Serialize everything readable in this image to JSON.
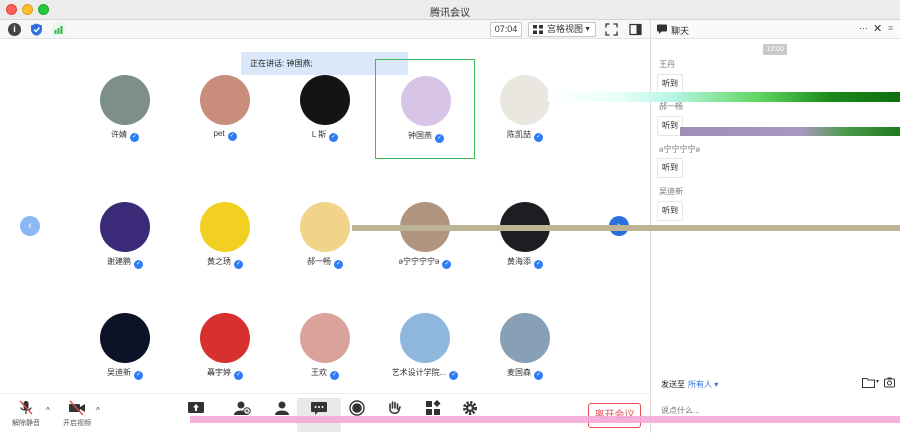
{
  "app": {
    "title": "腾讯会议"
  },
  "toolbar": {
    "timer": "07:04",
    "view_mode": "宫格视图"
  },
  "gallery": {
    "speaking_label": "正在讲话: 钟国燕;",
    "participants": [
      {
        "name": "许婧",
        "avatar_color": "#7d8f8a"
      },
      {
        "name": "pet",
        "avatar_color": "#c98d7c"
      },
      {
        "name": "L 斯",
        "avatar_color": "#141414"
      },
      {
        "name": "钟国燕",
        "avatar_color": "#d8c4e6"
      },
      {
        "name": "陈凯喆",
        "avatar_color": "#e9e7df"
      },
      {
        "name": "谢建鹏",
        "avatar_color": "#3a2a77"
      },
      {
        "name": "黄之琇",
        "avatar_color": "#f2d022"
      },
      {
        "name": "郝一畅",
        "avatar_color": "#f1d48a"
      },
      {
        "name": "ə宁宁宁宁ə",
        "avatar_color": "#b09480"
      },
      {
        "name": "黄海添",
        "avatar_color": "#1c1e24"
      },
      {
        "name": "吴迪新",
        "avatar_color": "#0c1326"
      },
      {
        "name": "聶宇婷",
        "avatar_color": "#d7302f"
      },
      {
        "name": "王欢",
        "avatar_color": "#d9a39b"
      },
      {
        "name": "艺术设计学院...",
        "avatar_color": "#8fb6dc"
      },
      {
        "name": "麦国森",
        "avatar_color": "#88a0b6"
      }
    ]
  },
  "bottombar": {
    "mute_label": "解除静音",
    "video_label": "开启视频",
    "end_label": "离开会议"
  },
  "chat": {
    "title": "聊天",
    "time": "13:00",
    "messages": [
      {
        "sender": "王丹",
        "text": "听到"
      },
      {
        "sender": "郝一畅",
        "text": "听到"
      },
      {
        "sender": "ə宁宁宁宁ə",
        "text": "听到"
      },
      {
        "sender": "吴迪新",
        "text": "听到"
      }
    ],
    "send_to_label": "发送至",
    "send_to_target": "所有人",
    "input_placeholder": "说点什么..."
  },
  "colors": {
    "accent": "#2e7bf6",
    "active_border": "#3cbd5d",
    "end_red": "#e24c4c",
    "speaking_bg": "#dbe8fa"
  }
}
